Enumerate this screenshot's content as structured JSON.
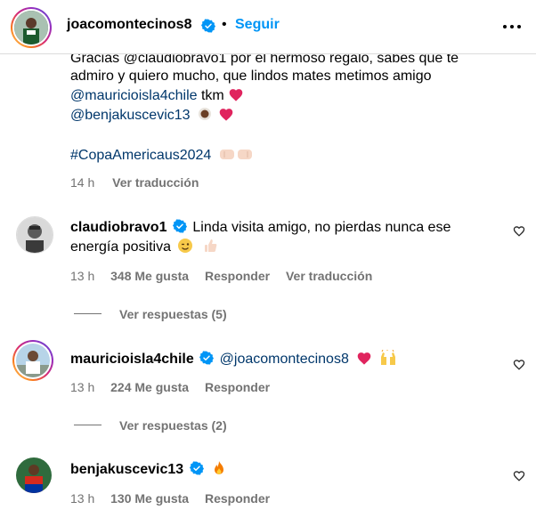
{
  "header": {
    "username": "joacomontecinos8",
    "separator": "•",
    "follow_label": "Seguir"
  },
  "caption": {
    "line1": "Gracias @claudiobravo1 por el hermoso regalo, sabes que te",
    "line2": "admiro y quiero mucho, que lindos mates metimos amigo",
    "mention_isla": "@mauricioisla4chile",
    "tkm": "tkm",
    "mention_benja": "@benjakuscevic13",
    "hashtag": "#CopaAmericaus2024",
    "time": "14 h",
    "translate": "Ver traducción"
  },
  "comments": [
    {
      "username": "claudiobravo1",
      "text_line1": "Linda visita amigo, no pierdas nunca ese",
      "text_line2": "energía positiva",
      "time": "13 h",
      "likes": "348 Me gusta",
      "reply": "Responder",
      "translate": "Ver traducción",
      "replies": "Ver respuestas (5)"
    },
    {
      "username": "mauricioisla4chile",
      "mention": "@joacomontecinos8",
      "time": "13 h",
      "likes": "224 Me gusta",
      "reply": "Responder",
      "replies": "Ver respuestas (2)"
    },
    {
      "username": "benjakuscevic13",
      "time": "13 h",
      "likes": "130 Me gusta",
      "reply": "Responder"
    }
  ],
  "icons": {
    "verified": "verified-badge-icon",
    "more": "more-options-icon",
    "like": "heart-outline-icon"
  },
  "colors": {
    "link": "#00376b",
    "follow": "#0095f6",
    "verified": "#0095f6",
    "secondary": "#737373",
    "heart_red": "#e0245e"
  }
}
